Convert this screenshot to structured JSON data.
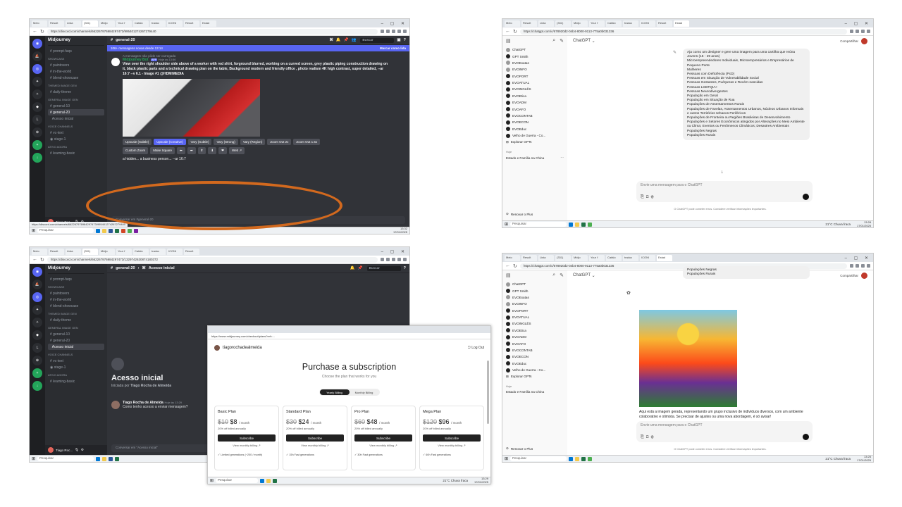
{
  "discord": {
    "tabs": [
      "Meio",
      "Result",
      "Lista",
      "(331)",
      "Midjo",
      "Your f",
      "Catálo",
      "traduc",
      "ICONI",
      "Result",
      "Estad"
    ],
    "url_top": "https://discord.com/channels/662267976984297473/995401274267279440",
    "url_bottom": "https://discord.com/channels/662267976984297473/1329742630874180372",
    "guild": "Midjourney",
    "channels_top": [
      "prompt-faqs"
    ],
    "cat_showcase": "SHOWCASE",
    "showcase": [
      "paintovers",
      "in-the-world",
      "blend-showcase"
    ],
    "cat_themed": "THEMED IMAGE GEN",
    "themed": [
      "daily-theme"
    ],
    "cat_general": "GENERAL IMAGE GEN",
    "general": [
      "general-10",
      "general-20",
      "Acesso inicial"
    ],
    "cat_voice": "VOICE CHANNELS",
    "voice": [
      "vc-text",
      "stage-1"
    ],
    "cat_active": "ATIVO AGORA",
    "active": [
      "learning-basic"
    ],
    "user_name": "Tiago Roc...",
    "user_status": "Disponível",
    "header_channel": "general-20",
    "header_thread": "Acesso inicial",
    "search_placeholder": "Buscar",
    "banner_text": "106+ mensagens novas desde 13:14",
    "banner_action": "Marcar como lida",
    "msg_notice": "A mensagem não pôde ser carregada",
    "bot_name": "Midjourney Bot",
    "bot_tag": "APP",
    "bot_time": "Hoje às 13:56",
    "prompt_text": "View over the right shoulder side above of a worker with red shirt, forground blurred, working on a curved screen, grey plastic piping construction drawing on it, black plastic parts and a technical drawing plan on the table, Background modern and friendly office , photo realism 4K high contrast, super detailed, --ar 16:7 --v 6.1 - Image #1 @HDMIMEDIA",
    "buttons": [
      "Upscale (Subtle)",
      "Upscale (Creative)",
      "Vary (Subtle)",
      "Vary (Strong)",
      "Vary (Region)",
      "Zoom Out 2x",
      "Zoom Out 1.5x",
      "Custom Zoom",
      "Make Square",
      "⬅",
      "➡",
      "⬆",
      "⬇",
      "❤",
      "Web ↗"
    ],
    "next_msg": "a hidden... a business person... --ar 16:7",
    "input_placeholder": "Conversar em #general-20",
    "status_url": "https://discord.com/channels/662267976984297473/995401274267279440",
    "thread_title": "Acesso inicial",
    "thread_started_prefix": "Iniciada por",
    "thread_author": "Tiago Rocha de Almeida",
    "thread_author_time": "Hoje às 13:29",
    "thread_message": "Como tenho acesso a enviar mensagem?",
    "thread_input": "Conversar em \"Acesso inicial\""
  },
  "chatgpt": {
    "url": "https://chatgpt.com/c/678920d2-04b4-8000-9113-775a0b031336",
    "model": "ChatGPT",
    "share": "Compartilhar",
    "sidebar": [
      "ChatGPT",
      "GPT Smith",
      "EVOExatas",
      "EVOINFO",
      "EVOPORT",
      "EVOATUAL",
      "EVOINGLÊS",
      "EVOEtica",
      "EVOADM",
      "EVOAFO",
      "EVOCONTAB",
      "EVOECON",
      "EVOEduc",
      "Velho de Guerra - Co...",
      "Explorar GPTs"
    ],
    "today_label": "Hoje",
    "chat_item": "Estado e Família na China",
    "upgrade": "Renovar o Plus",
    "bubble_lines": [
      "Aja como um designer e gere uma imagem para uma cartilha que reúna Jovens (15 - 29 anos)",
      "Microempreendedores Individuais, Microempresários e Empresários de Pequeno Porte",
      "Mulheres",
      "Pessoas com Deficiência (PcD)",
      "Pessoas em Situação de Vulnerabilidade Social",
      "Pessoas Gestantes, Puérperas e Recém-nascidas",
      "Pessoas LGBTQIA+",
      "Pessoas Neurodivergentes",
      "População em Geral",
      "População em Situação de Rua",
      "Populações de Assentamentos Rurais",
      "Populações de Favelas, Assentamentos Urbanos, Núcleos Urbanos Informais e outros Territórios Urbanos Periféricos",
      "Populações de Fronteira ou Regiões Brasileiras de Desenvolvimento",
      "Populações e Setores Econômicos atingidos por Alterações no Meio Ambiente ou Clima; Eventos ou Fenômenos Climáticos; Desastres Ambientais",
      "Populações Negras",
      "Populações Rurais"
    ],
    "bubble_tail": [
      "Populações Negras",
      "Populações Rurais"
    ],
    "input_placeholder": "Envie uma mensagem para o ChatGPT",
    "footer": "O ChatGPT pode cometer erros. Considere verificar informações importantes.",
    "answer": "Aqui está a imagem gerada, representando um grupo inclusivo de indivíduos diversos, com um ambiente colaborativo e otimista. Se precisar de ajustes ou uma nova abordagem, é só avisar!"
  },
  "midjourney": {
    "url": "https://www.midjourney.com/checkout/plans?ref=...",
    "user": "tiagorochadealmeida",
    "logout": "Log Out",
    "title": "Purchase a subscription",
    "subtitle": "Choose the plan that works for you",
    "toggle_yearly": "Yearly Billing",
    "toggle_monthly": "Monthly Billing",
    "plans": [
      {
        "name": "Basic Plan",
        "old": "$10",
        "price": "$8",
        "per": "/ month",
        "disc": "20% off billed annually",
        "feat": "Limited generations (~200 / month)"
      },
      {
        "name": "Standard Plan",
        "old": "$30",
        "price": "$24",
        "per": "/ month",
        "disc": "20% off billed annually",
        "feat": "15h Fast generations"
      },
      {
        "name": "Pro Plan",
        "old": "$60",
        "price": "$48",
        "per": "/ month",
        "disc": "20% off billed annually",
        "feat": "30h Fast generations"
      },
      {
        "name": "Mega Plan",
        "old": "$120",
        "price": "$96",
        "per": "/ month",
        "disc": "20% off billed annually",
        "feat": "60h Fast generations"
      }
    ],
    "subscribe": "Subscribe",
    "view_monthly": "View monthly billing ↗"
  },
  "taskbar": {
    "search": "Pesquisar",
    "weather": "21°C Chuva fraca",
    "lang": "POR PTB",
    "time_a": "13:32",
    "time_b": "13:28",
    "time_c": "13:29",
    "time_d": "13:25",
    "date": "17/01/2025"
  },
  "colors": {
    "discord_bg": "#313338",
    "discord_blurple": "#5865f2",
    "highlight_ellipse": "#d2691e"
  }
}
